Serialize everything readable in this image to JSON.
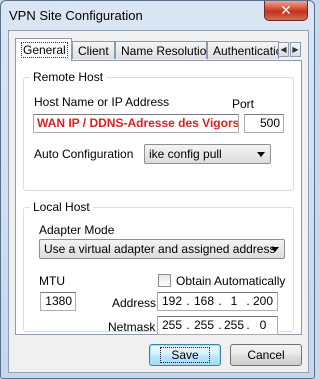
{
  "window": {
    "title": "VPN Site Configuration",
    "close_glyph": "✕"
  },
  "tabs": [
    {
      "label": "General",
      "active": true
    },
    {
      "label": "Client"
    },
    {
      "label": "Name Resolution"
    },
    {
      "label": "Authenticatic"
    }
  ],
  "tab_scroll": {
    "left": "◀",
    "right": "▶"
  },
  "remote_host": {
    "group_title": "Remote Host",
    "host_label": "Host Name or IP Address",
    "host_value": "WAN IP / DDNS-Adresse des Vigors",
    "port_label": "Port",
    "port_value": "500",
    "auto_config_label": "Auto Configuration",
    "auto_config_value": "ike config pull"
  },
  "local_host": {
    "group_title": "Local Host",
    "adapter_mode_label": "Adapter Mode",
    "adapter_mode_value": "Use a virtual adapter and assigned address",
    "mtu_label": "MTU",
    "mtu_value": "1380",
    "obtain_label": "Obtain Automatically",
    "obtain_checked": false,
    "address_label": "Address",
    "address": [
      "192",
      "168",
      "1",
      "200"
    ],
    "netmask_label": "Netmask",
    "netmask": [
      "255",
      "255",
      "255",
      "0"
    ],
    "dot": "."
  },
  "buttons": {
    "save": "Save",
    "cancel": "Cancel"
  }
}
